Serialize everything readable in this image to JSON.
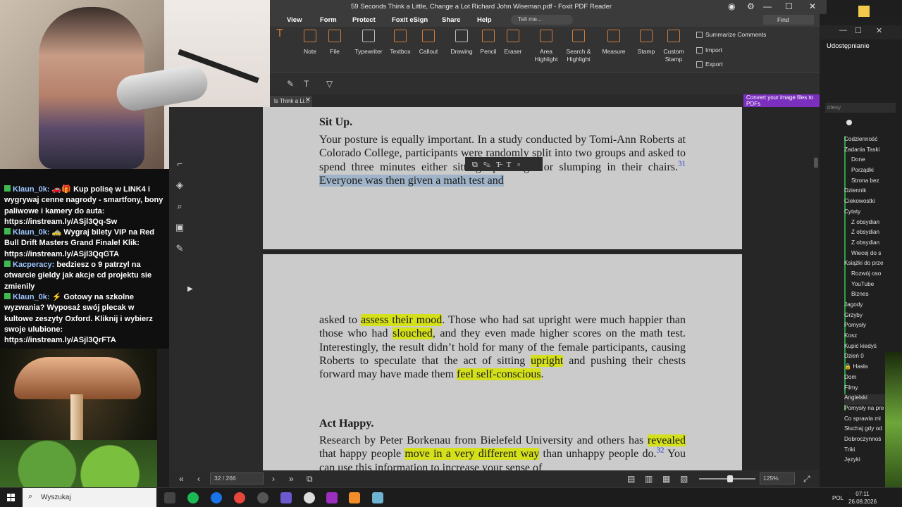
{
  "window": {
    "title": "59 Seconds Think a Little, Change a Lot Richard John Wiseman.pdf - Foxit PDF Reader",
    "menu_tabs": [
      "View",
      "Form",
      "Protect",
      "Foxit eSign",
      "Share",
      "Help"
    ],
    "tell_me": "Tell me...",
    "find": "Find"
  },
  "ribbon": {
    "tools": [
      "Note",
      "File",
      "Typewriter",
      "Textbox",
      "Callout",
      "Drawing",
      "Pencil",
      "Eraser",
      "Area Highlight",
      "Search & Highlight",
      "Measure",
      "Stamp",
      "Custom Stamp"
    ],
    "right_actions": [
      "Summarize Comments",
      "Import",
      "Export"
    ]
  },
  "doc_tab": {
    "label": "ls Think a Li...",
    "close": "✕"
  },
  "ad": {
    "text": "Convert your image files to PDFs"
  },
  "chat": {
    "messages": [
      {
        "user": "Klaun_0k:",
        "text": "🚗🎁 Kup polisę w LINK4 i wygrywaj cenne nagrody - smartfony, bony paliwowe i kamery do auta: https://instream.ly/ASjl3Qq-Sw"
      },
      {
        "user": "Klaun_0k:",
        "text": "🚕 Wygraj bilety VIP na Red Bull Drift Masters Grand Finale! Klik: https://instream.ly/ASjl3QqGTA"
      },
      {
        "user": "Kacperacy:",
        "text": "bedziesz o 9 patrzyl na otwarcie gieldy jak akcje cd projektu sie zmienily"
      },
      {
        "user": "Klaun_0k:",
        "text": "⚡ Gotowy na szkolne wyzwania? Wyposaż swój plecak w kultowe zeszyty Oxford. Kliknij i wybierz swoje ulubione: https://instream.ly/ASjl3QrFTA"
      }
    ]
  },
  "document": {
    "heading1": "Sit Up.",
    "p1_part1": "Your posture is equally important. In a study conducted by Tomi-Ann Roberts at Colorado College, participants were randomly split into two groups and asked to spend",
    "p1_hidden": "three minutes",
    "p1_part2": "either sitting up straight or slumping in their chairs.",
    "fn31": "31",
    "p1_hl": "Everyone was then given a math test and",
    "p2_a": "asked to",
    "p2_hl1": "assess their mood",
    "p2_b": ". Those who had sat upright were much happier than those who had",
    "p2_hl2": "slouched",
    "p2_c": ", and they even made higher scores on the math test. Interestingly, the result didn’t hold for many of the female participants, causing Roberts to speculate that the act of sitting",
    "p2_hl3": "upright",
    "p2_d": "and pushing their chests forward may have made them",
    "p2_hl4": "feel self-conscious",
    "p2_e": ".",
    "heading2": "Act Happy.",
    "p3_a": "Research by Peter Borkenau from Bielefeld University and others has",
    "p3_hl1": "revealed",
    "p3_b": "that happy people",
    "p3_hl2": "move in a very different way",
    "p3_c": "than unhappy people do.",
    "fn32": "32",
    "p3_d": "You can use this information to increase your sense of"
  },
  "status": {
    "page": "32 / 266",
    "zoom": "125%"
  },
  "rightapp": {
    "share": "Udostępnianie",
    "search_placeholder": "otesy",
    "tree": [
      {
        "label": "Codzienność",
        "level": 1
      },
      {
        "label": "Zadania Taski",
        "level": 1
      },
      {
        "label": "Done",
        "level": 2
      },
      {
        "label": "Porządki",
        "level": 2
      },
      {
        "label": "Strona bez",
        "level": 2
      },
      {
        "label": "Dziennik",
        "level": 1
      },
      {
        "label": "Ciekowostki",
        "level": 1
      },
      {
        "label": "Cytaty",
        "level": 1
      },
      {
        "label": "Z obsydian",
        "level": 2
      },
      {
        "label": "Z obsydian",
        "level": 2
      },
      {
        "label": "Z obsydian",
        "level": 2
      },
      {
        "label": "Wiecej do s",
        "level": 2
      },
      {
        "label": "Książki do prze",
        "level": 1
      },
      {
        "label": "Rozwój oso",
        "level": 2
      },
      {
        "label": "YouTube",
        "level": 2
      },
      {
        "label": "Biznes",
        "level": 2
      },
      {
        "label": "Jagody",
        "level": 1
      },
      {
        "label": "Grzyby",
        "level": 1
      },
      {
        "label": "Pomysły",
        "level": 1
      },
      {
        "label": "Kosz",
        "level": 1
      },
      {
        "label": "Kupić kiedyś",
        "level": 1
      },
      {
        "label": "Dzień 0",
        "level": 1
      },
      {
        "label": "🔒 Hasła",
        "level": 1
      },
      {
        "label": "Dom",
        "level": 1
      },
      {
        "label": "Filmy",
        "level": 1
      },
      {
        "label": "Angielski",
        "level": 1
      },
      {
        "label": "Pomysły na pre",
        "level": 1
      },
      {
        "label": "Co sprawia mi",
        "level": 1
      },
      {
        "label": "Słuchaj gdy od",
        "level": 1
      },
      {
        "label": "Dobroczynnoś",
        "level": 1
      },
      {
        "label": "Triki",
        "level": 1
      },
      {
        "label": "Języki",
        "level": 1
      }
    ]
  },
  "taskbar": {
    "search": "Wyszukaj",
    "lang": "POL",
    "time": "07:11",
    "date": "26.08.2026"
  }
}
